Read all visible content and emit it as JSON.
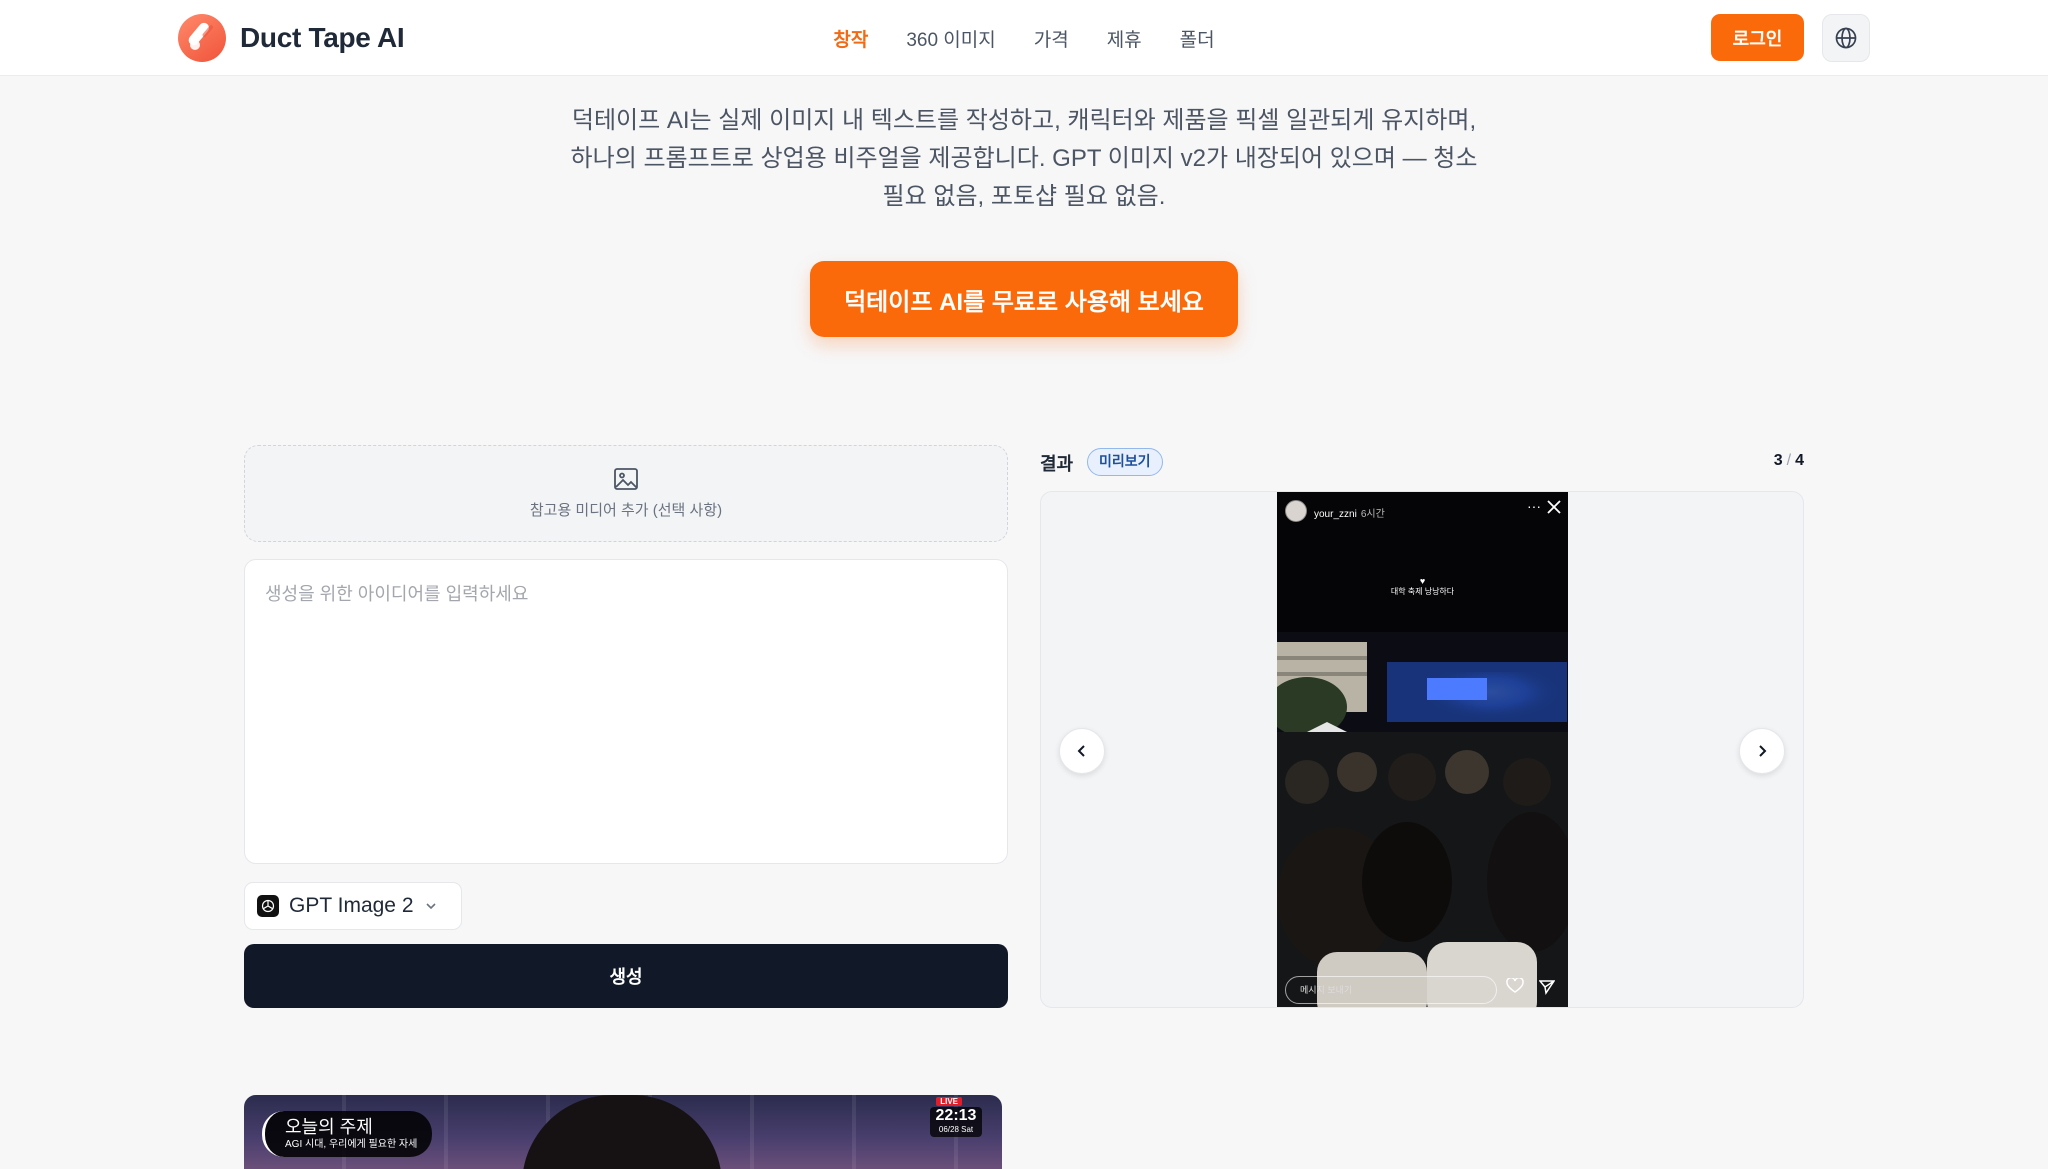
{
  "header": {
    "brand": "Duct Tape AI",
    "nav": [
      {
        "label": "창작",
        "active": true
      },
      {
        "label": "360 이미지",
        "active": false
      },
      {
        "label": "가격",
        "active": false
      },
      {
        "label": "제휴",
        "active": false
      },
      {
        "label": "폴더",
        "active": false
      }
    ],
    "login_label": "로그인",
    "language_icon": "globe-icon"
  },
  "hero": {
    "description": "덕테이프 AI는 실제 이미지 내 텍스트를 작성하고, 캐릭터와 제품을 픽셀 일관되게 유지하며, 하나의 프롬프트로 상업용 비주얼을 제공합니다. GPT 이미지 v2가 내장되어 있으며 — 청소 필요 없음, 포토샵 필요 없음.",
    "cta_label": "덕테이프 AI를 무료로 사용해 보세요"
  },
  "composer": {
    "upload_label": "참고용 미디어 추가 (선택 사항)",
    "upload_icon": "image-icon",
    "prompt_placeholder": "생성을 위한 아이디어를 입력하세요",
    "prompt_value": "",
    "model": "GPT Image 2",
    "generate_label": "생성"
  },
  "result": {
    "title": "결과",
    "badge": "미리보기",
    "current": "3",
    "total": "4",
    "story": {
      "username": "your_zzni",
      "time": "6시간",
      "caption": "대학 축제 낭낭하다",
      "message_placeholder": "메시지 보내기"
    }
  },
  "video": {
    "topic_title": "오늘의 주제",
    "topic_sub": "AGI 시대, 우리에게 필요한 자세",
    "live": "LIVE",
    "time": "22:13",
    "date": "06/28 Sat"
  },
  "colors": {
    "accent": "#fb6a0a",
    "dark": "#111827",
    "badge_bg": "#e7f0fc"
  }
}
